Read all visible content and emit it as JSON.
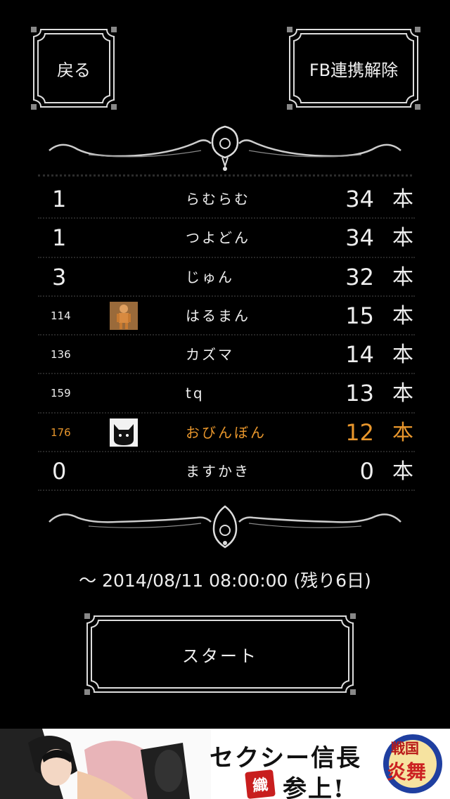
{
  "header": {
    "back_label": "戻る",
    "fb_unlink_label": "FB連携解除"
  },
  "ranking": [
    {
      "rank": "1",
      "name": "らむらむ",
      "score": "34",
      "unit": "本"
    },
    {
      "rank": "1",
      "name": "つよどん",
      "score": "34",
      "unit": "本"
    },
    {
      "rank": "3",
      "name": "じゅん",
      "score": "32",
      "unit": "本"
    },
    {
      "rank": "114",
      "name": "はるまん",
      "score": "15",
      "unit": "本"
    },
    {
      "rank": "136",
      "name": "カズマ",
      "score": "14",
      "unit": "本"
    },
    {
      "rank": "159",
      "name": "tq",
      "score": "13",
      "unit": "本"
    },
    {
      "rank": "176",
      "name": "おびんぼん",
      "score": "12",
      "unit": "本"
    },
    {
      "rank": "0",
      "name": "ますかき",
      "score": "0",
      "unit": "本"
    }
  ],
  "deadline": "～ 2014/08/11 08:00:00 (残り6日)",
  "start_label": "スタート",
  "ad": {
    "headline": "セクシー信長",
    "seal": "織",
    "sub": "参上!",
    "logo_line1": "戦国",
    "logo_line2": "炎舞"
  },
  "colors": {
    "highlight": "#e8962c",
    "background": "#000000",
    "text": "#eeeeee"
  }
}
